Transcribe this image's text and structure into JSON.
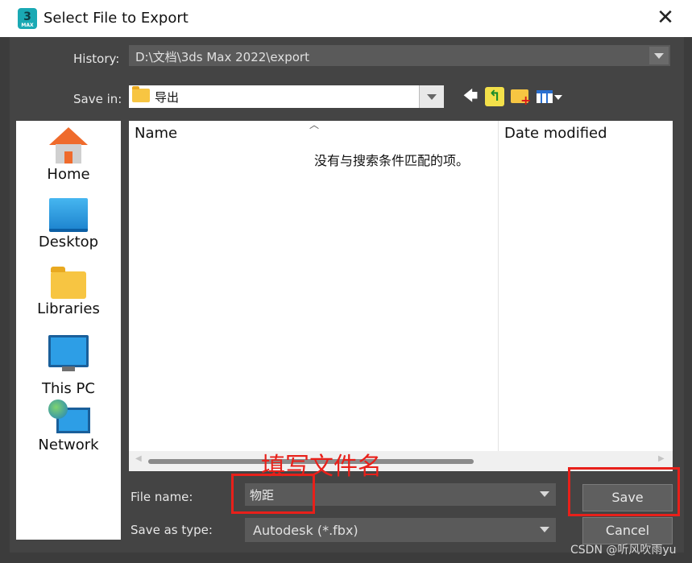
{
  "window": {
    "title": "Select File to Export",
    "app_icon_text": "3",
    "app_icon_sub": "MAX"
  },
  "history": {
    "label": "History:",
    "value": "D:\\文档\\3ds Max 2022\\export"
  },
  "save_in": {
    "label": "Save in:",
    "value": "导出"
  },
  "places": [
    {
      "label": "Home"
    },
    {
      "label": "Desktop"
    },
    {
      "label": "Libraries"
    },
    {
      "label": "This PC"
    },
    {
      "label": "Network"
    }
  ],
  "file_list": {
    "columns": [
      "Name",
      "Date modified"
    ],
    "empty_message": "没有与搜索条件匹配的项。"
  },
  "file_name": {
    "label": "File name:",
    "value": "物距"
  },
  "save_as_type": {
    "label": "Save as type:",
    "value": "Autodesk (*.fbx)"
  },
  "buttons": {
    "save": "Save",
    "cancel": "Cancel"
  },
  "annotation": "填写文件名",
  "watermark": "CSDN @听风吹雨yu",
  "colors": {
    "annotation_red": "#e8201a",
    "dialog_bg": "#444444"
  }
}
